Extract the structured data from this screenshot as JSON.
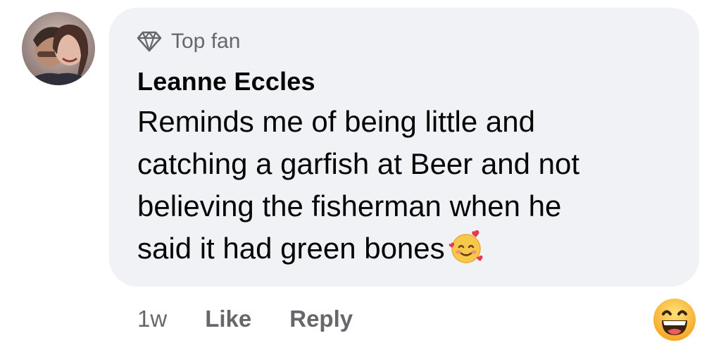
{
  "comment": {
    "author": "Leanne Eccles",
    "badge": {
      "label": "Top fan",
      "icon": "diamond-icon"
    },
    "text_lines": [
      "Reminds me of being little and",
      "catching a garfish at Beer and not",
      "believing the fisherman when he",
      "said it had green bones"
    ],
    "inline_emoji": "smiling-face-with-hearts-icon",
    "time": "1w",
    "actions": {
      "like": "Like",
      "reply": "Reply"
    },
    "reaction_icon": "grinning-face-icon"
  },
  "colors": {
    "bubble_bg": "#f0f2f5",
    "meta_text": "#65676b",
    "primary_text": "#050505"
  }
}
